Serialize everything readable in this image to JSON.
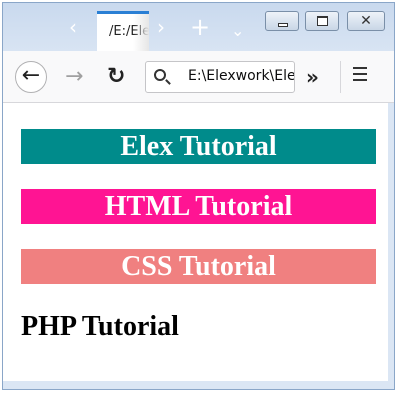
{
  "browser": {
    "tab_title": "/E:/Ele",
    "tab_prev_glyph": "‹",
    "tab_next_glyph": "›",
    "new_tab_glyph": "+",
    "tab_list_glyph": "⌄",
    "close_glyph": "✕",
    "back_glyph": "←",
    "forward_glyph": "→",
    "reload_glyph": "↻",
    "overflow_glyph": "»",
    "url": "E:\\Elexwork\\Ele"
  },
  "page": {
    "headings": [
      {
        "text": "Elex Tutorial",
        "bg": "#008b8b",
        "color": "#ffffff"
      },
      {
        "text": "HTML Tutorial",
        "bg": "#ff1493",
        "color": "#ffffff"
      },
      {
        "text": "CSS Tutorial",
        "bg": "#f08080",
        "color": "#ffffff"
      },
      {
        "text": "PHP Tutorial",
        "bg": "transparent",
        "color": "#000000"
      }
    ]
  },
  "icons": {
    "back": "back-arrow-icon",
    "forward": "forward-arrow-icon",
    "reload": "reload-icon",
    "search": "search-icon",
    "overflow": "double-chevron-icon",
    "menu": "hamburger-menu-icon"
  }
}
